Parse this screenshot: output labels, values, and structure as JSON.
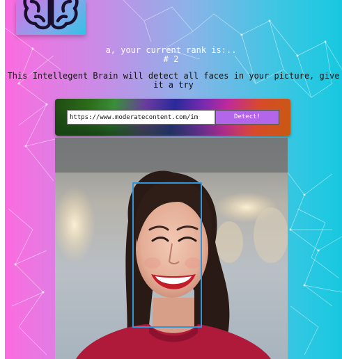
{
  "header": {
    "rank_message": "a, your current rank is:..",
    "rank_value": "# 2"
  },
  "intro": {
    "tagline": "This Intellegent Brain will detect all faces in your picture, give it a try"
  },
  "detect_form": {
    "url_value": "https://www.moderatecontent.com/im",
    "button_label": "Detect!"
  },
  "logo": {
    "icon": "brain-icon"
  },
  "result": {
    "faces_detected": 1
  },
  "colors": {
    "gradient_left": "#fb6ce0",
    "gradient_right": "#17c8e0",
    "button": "#b466ea",
    "face_box": "#2f95dd"
  }
}
